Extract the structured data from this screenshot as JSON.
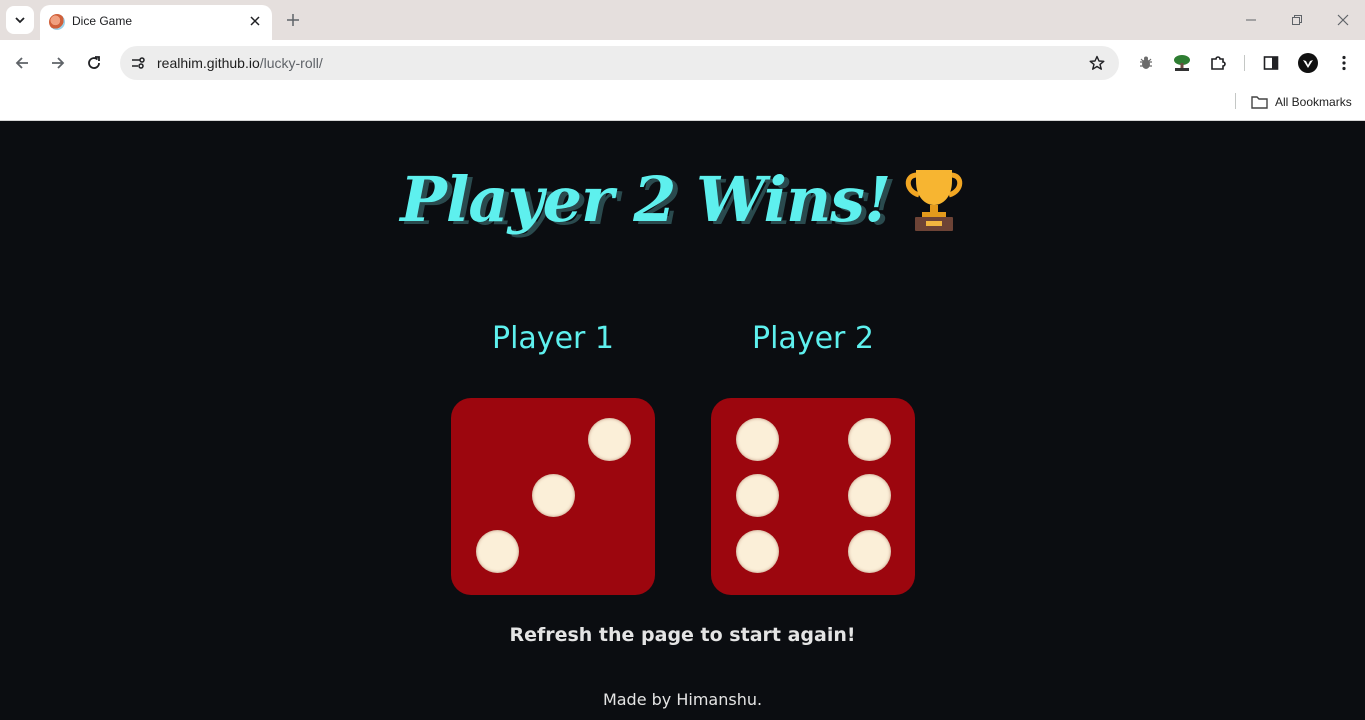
{
  "browser": {
    "tab_title": "Dice Game",
    "url_host": "realhim.github.io",
    "url_path": "/lucky-roll/",
    "bookmarks_label": "All Bookmarks",
    "icons": [
      "tab-list-icon",
      "close-icon",
      "plus-icon",
      "minimize-icon",
      "restore-icon",
      "back-icon",
      "forward-icon",
      "reload-icon",
      "site-info-icon",
      "star-icon",
      "bug-extension-icon",
      "tree-extension-icon",
      "puzzle-icon",
      "side-panel-icon",
      "profile-icon",
      "more-menu-icon",
      "folder-icon"
    ]
  },
  "game": {
    "headline": "Player 2 Wins!",
    "headline_icon": "trophy-icon",
    "accent_color": "#5ef0ee",
    "die_color": "#9c060e",
    "pip_color": "#fbefd8",
    "players": [
      {
        "label": "Player 1",
        "die_value": 3
      },
      {
        "label": "Player 2",
        "die_value": 6
      }
    ],
    "refresh_text": "Refresh the page to start again!",
    "footer_text": "Made by Himanshu."
  }
}
